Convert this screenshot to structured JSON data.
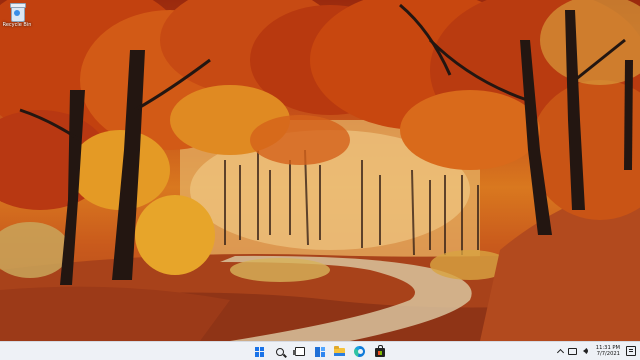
{
  "desktop": {
    "icons": [
      {
        "label": "Recycle Bin",
        "icon": "recycle-bin-icon"
      }
    ],
    "wallpaper": "autumn-forest-road"
  },
  "taskbar": {
    "apps": [
      {
        "name": "Start",
        "icon": "windows-start-icon"
      },
      {
        "name": "Search",
        "icon": "search-icon"
      },
      {
        "name": "Task View",
        "icon": "task-view-icon"
      },
      {
        "name": "Widgets",
        "icon": "widgets-icon"
      },
      {
        "name": "File Explorer",
        "icon": "folder-icon"
      },
      {
        "name": "Microsoft Edge",
        "icon": "edge-icon"
      },
      {
        "name": "Microsoft Store",
        "icon": "store-icon"
      }
    ],
    "tray": {
      "time": "11:31 PM",
      "date": "7/7/2021"
    }
  },
  "colors": {
    "taskbar_bg": "#eef1f6",
    "accent": "#1a73e8"
  }
}
